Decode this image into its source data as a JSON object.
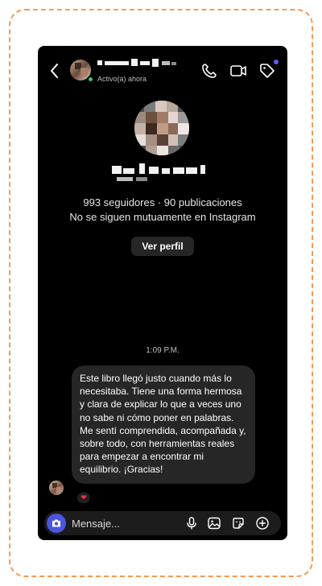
{
  "header": {
    "status": "Activo(a) ahora"
  },
  "profile": {
    "stats": "993 seguidores · 90 publicaciones",
    "mutual": "No se siguen mutuamente en Instagram",
    "view_profile_label": "Ver perfil"
  },
  "chat": {
    "timestamp": "1:09 P.M.",
    "message": "Este libro llegó justo cuando más lo necesitaba. Tiene una forma hermosa y clara de explicar lo que a veces uno no sabe ni cómo poner en palabras. Me sentí comprendida, acompañada y, sobre todo, con herramientas reales para empezar a encontrar mi equilibrio. ¡Gracias!",
    "reaction": "❤"
  },
  "composer": {
    "placeholder": "Mensaje..."
  },
  "icons": {
    "back": "chevron-left-icon",
    "call": "phone-icon",
    "video": "video-camera-icon",
    "tag": "tag-icon",
    "camera": "camera-icon",
    "mic": "microphone-icon",
    "gallery": "image-icon",
    "sticker": "sticker-icon",
    "add": "plus-circle-icon"
  },
  "colors": {
    "background": "#000000",
    "bubble": "#262626",
    "accent": "#4b56e0",
    "online": "#31d158",
    "frame_border": "#f39a55"
  }
}
